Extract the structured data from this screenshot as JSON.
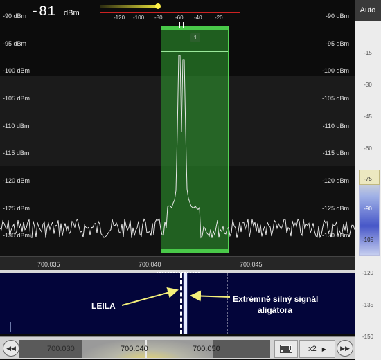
{
  "readout": {
    "level": "-81",
    "unit": "dBm"
  },
  "smeter": {
    "ticks": [
      "-120",
      "-100",
      "-80",
      "-60",
      "-40",
      "-20"
    ]
  },
  "db_labels": [
    "-90 dBm",
    "-95 dBm",
    "-100 dBm",
    "-105 dBm",
    "-110 dBm",
    "-115 dBm",
    "-120 dBm",
    "-125 dBm",
    "-130 dBm"
  ],
  "marker": {
    "label": "1"
  },
  "freq_axis": [
    "700.035",
    "700.040",
    "700.045"
  ],
  "right_panel": {
    "auto_label": "Auto",
    "scale": [
      "-15",
      "-30",
      "-45",
      "-60",
      "-75",
      "-90",
      "-105",
      "-120",
      "-135",
      "-150"
    ]
  },
  "waterfall": {
    "annotation_left": "LEILA",
    "annotation_right_line1": "Extrémně silný signál",
    "annotation_right_line2": "aligátora"
  },
  "bottom_bar": {
    "track_labels": [
      "700.030",
      "700.040",
      "700.050"
    ],
    "zoom_label": "x2"
  },
  "colors": {
    "accent_green": "#2fa32f",
    "smeter_yellow": "#e8e03a",
    "waterfall_bg": "#03053a"
  }
}
